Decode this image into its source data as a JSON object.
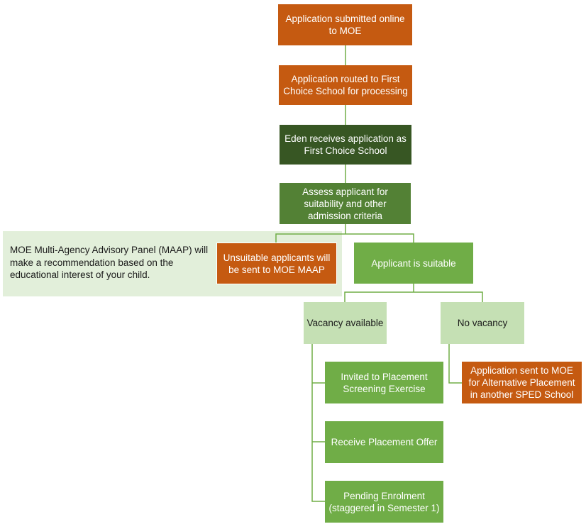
{
  "diagram": {
    "title": "",
    "nodes": {
      "submitted": "Application submitted online to MOE",
      "routed": "Application routed to First Choice School for processing",
      "eden": "Eden receives application as First Choice School",
      "assess": "Assess applicant for suitability and other admission criteria",
      "unsuitable": "Unsuitable applicants will be sent to MOE MAAP",
      "suitable": "Applicant is suitable",
      "vacancy": "Vacancy available",
      "no_vacancy": "No vacancy",
      "invited": "Invited to Placement Screening Exercise",
      "offer": "Receive Placement Offer",
      "pending": "Pending Enrolment (staggered in Semester 1)",
      "alternative": "Application sent to MOE for Alternative Placement in another SPED School"
    },
    "note": "MOE Multi-Agency Advisory Panel (MAAP) will make a recommendation based on the educational interest of your child.",
    "colors": {
      "orange": "#c55a11",
      "dark_green": "#375623",
      "mid_green": "#538135",
      "green": "#70ad47",
      "pale_green": "#c5e0b4",
      "note_bg": "#e2efda",
      "connector": "#70ad47"
    }
  }
}
